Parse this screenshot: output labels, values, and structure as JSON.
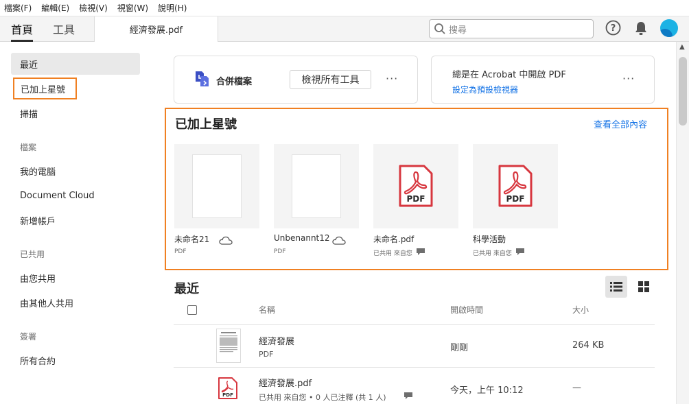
{
  "menu": [
    "檔案(F)",
    "編輯(E)",
    "檢視(V)",
    "視窗(W)",
    "說明(H)"
  ],
  "tabs": {
    "home": "首頁",
    "tools": "工具",
    "document": "經濟發展.pdf"
  },
  "search": {
    "placeholder": "搜尋"
  },
  "sidebar": {
    "recent": "最近",
    "starred": "已加上星號",
    "scan": "掃描",
    "files_head": "檔案",
    "my_computer": "我的電腦",
    "document_cloud": "Document Cloud",
    "add_account": "新增帳戶",
    "shared_head": "已共用",
    "shared_by_you": "由您共用",
    "shared_by_others": "由其他人共用",
    "sign_head": "簽署",
    "all_agreements": "所有合約"
  },
  "cards": {
    "combine_label": "合併檔案",
    "view_all_tools": "檢視所有工具",
    "more": "···",
    "always_open": "總是在 Acrobat 中開啟 PDF",
    "set_default": "設定為預設檢視器"
  },
  "starred": {
    "title": "已加上星號",
    "see_all": "查看全部內容",
    "items": [
      {
        "name": "未命名21",
        "sub": "PDF"
      },
      {
        "name": "Unbenannt12",
        "sub": "PDF"
      },
      {
        "name": "未命名.pdf",
        "sub": "已共用 來自您"
      },
      {
        "name": "科學活動",
        "sub": "已共用 來自您"
      }
    ],
    "pdf_label": "PDF"
  },
  "recent": {
    "title": "最近",
    "columns": {
      "name": "名稱",
      "opened": "開啟時間",
      "size": "大小"
    },
    "rows": [
      {
        "name": "經濟發展",
        "sub": "PDF",
        "opened": "剛剛",
        "size": "264 KB"
      },
      {
        "name": "經濟發展.pdf",
        "sub": "已共用 來自您 • 0 人已注釋 (共 1 人)",
        "opened": "今天，上午 10:12",
        "size": "—"
      }
    ]
  },
  "colors": {
    "accent": "#1473e6",
    "highlight": "#f08022",
    "pdf_red": "#d7373f"
  }
}
